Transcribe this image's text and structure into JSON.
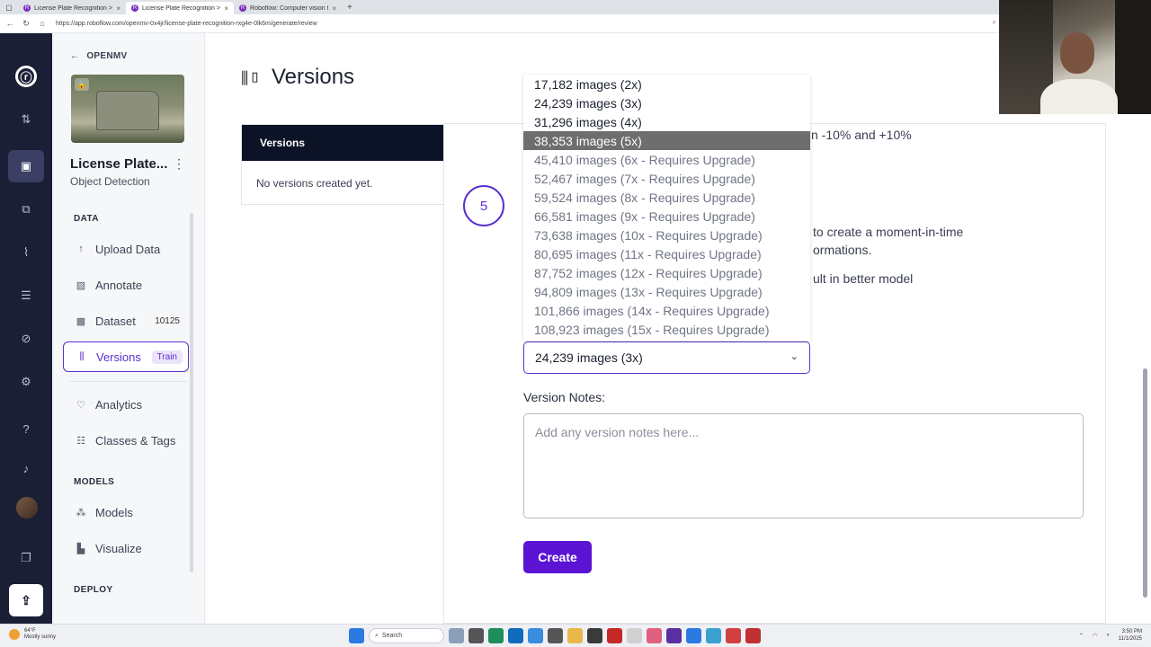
{
  "browser": {
    "tabs": [
      {
        "title": "License Plate Recognition > Mo...",
        "active": false
      },
      {
        "title": "License Plate Recognition > Crea...",
        "active": true
      },
      {
        "title": "Roboflow: Computer vision tools...",
        "active": false
      }
    ],
    "url": "https://app.roboflow.com/openmv-0x4jr/license-plate-recognition-rxg4e-0lk6m/generate/review"
  },
  "sidebar": {
    "workspace": "OPENMV",
    "project_name": "License Plate...",
    "project_type": "Object Detection",
    "sections": {
      "data": "DATA",
      "models": "MODELS",
      "deploy": "DEPLOY"
    },
    "data_items": [
      {
        "label": "Upload Data",
        "icon": "upload-arrow-icon"
      },
      {
        "label": "Annotate",
        "icon": "annotate-icon"
      },
      {
        "label": "Dataset",
        "icon": "image-icon",
        "count": "10125"
      },
      {
        "label": "Versions",
        "icon": "versions-icon",
        "badge": "Train"
      },
      {
        "label": "Analytics",
        "icon": "heart-pulse-icon"
      },
      {
        "label": "Classes & Tags",
        "icon": "list-icon"
      }
    ],
    "model_items": [
      {
        "label": "Models",
        "icon": "network-icon"
      },
      {
        "label": "Visualize",
        "icon": "bar-chart-icon"
      }
    ]
  },
  "main": {
    "title": "Versions",
    "versions_card": {
      "header": "Versions",
      "empty": "No versions created yet."
    },
    "step_number": "5",
    "partial_texts": {
      "line1": "n -10% and +10%",
      "line2": "to create a moment-in-time",
      "line3": "ormations.",
      "line4": "ult in better model"
    },
    "size_select": {
      "selected": "24,239 images (3x)"
    },
    "size_options": [
      {
        "label": "17,182 images (2x)",
        "upgrade": false
      },
      {
        "label": "24,239 images (3x)",
        "upgrade": false
      },
      {
        "label": "31,296 images (4x)",
        "upgrade": false
      },
      {
        "label": "38,353 images (5x)",
        "upgrade": false,
        "highlighted": true
      },
      {
        "label": "45,410 images (6x - Requires Upgrade)",
        "upgrade": true
      },
      {
        "label": "52,467 images (7x - Requires Upgrade)",
        "upgrade": true
      },
      {
        "label": "59,524 images (8x - Requires Upgrade)",
        "upgrade": true
      },
      {
        "label": "66,581 images (9x - Requires Upgrade)",
        "upgrade": true
      },
      {
        "label": "73,638 images (10x - Requires Upgrade)",
        "upgrade": true
      },
      {
        "label": "80,695 images (11x - Requires Upgrade)",
        "upgrade": true
      },
      {
        "label": "87,752 images (12x - Requires Upgrade)",
        "upgrade": true
      },
      {
        "label": "94,809 images (13x - Requires Upgrade)",
        "upgrade": true
      },
      {
        "label": "101,866 images (14x - Requires Upgrade)",
        "upgrade": true
      },
      {
        "label": "108,923 images (15x - Requires Upgrade)",
        "upgrade": true
      }
    ],
    "notes_label": "Version Notes:",
    "notes_placeholder": "Add any version notes here...",
    "create_label": "Create"
  },
  "taskbar": {
    "weather_temp": "64°F",
    "weather_desc": "Mostly sunny",
    "search_label": "Search",
    "time": "3:50 PM",
    "date": "11/1/2025"
  },
  "colors": {
    "accent": "#5b13d4",
    "rail": "#1a1f36",
    "highlight": "#6e6e6e"
  }
}
